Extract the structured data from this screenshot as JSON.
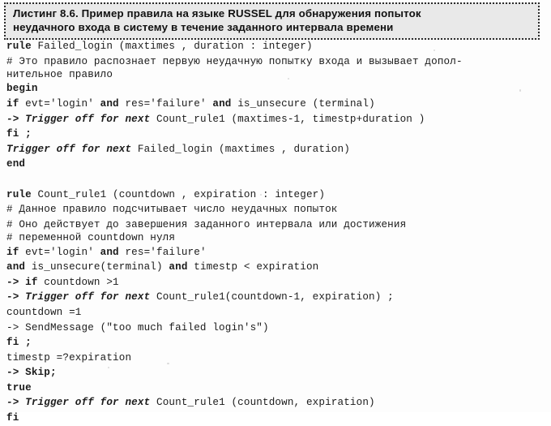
{
  "caption": {
    "line1": "Листинг 8.6. Пример правила на языке RUSSEL для обнаружения попыток",
    "line2": "неудачного входа в систему в течение заданного интервала времени"
  },
  "colors": {
    "page_background": "#fdfdfd",
    "caption_background": "#e9e9e9",
    "caption_border": "#2b2b2b",
    "text": "#1b1b1b"
  },
  "listing": {
    "language": "RUSSEL",
    "lines": [
      {
        "id": "l01",
        "kw": "rule",
        "rest": " Failed_login (maxtimes , duration : integer)"
      },
      {
        "id": "l02",
        "kw": "",
        "rest": "# Это правило распознает первую неудачную попытку входа и вызывает допол-"
      },
      {
        "id": "l03",
        "kw": "",
        "rest": "нительное правило"
      },
      {
        "id": "l04",
        "kw": "begin",
        "rest": ""
      },
      {
        "id": "l05",
        "kw": "if",
        "rest": " evt='login' ",
        "kw2": "and",
        "rest2": " res='failure' ",
        "kw3": "and",
        "rest3": " is_unsecure (terminal)"
      },
      {
        "id": "l06",
        "kw": "-> Trigger off for next",
        "rest": " Count_rule1 (maxtimes-1, timestp+duration )"
      },
      {
        "id": "l07",
        "kw": "fi ;",
        "rest": ""
      },
      {
        "id": "l08",
        "kw": "Trigger off for next",
        "rest": " Failed_login (maxtimes , duration)"
      },
      {
        "id": "l09",
        "kw": "end",
        "rest": ""
      },
      {
        "id": "l10",
        "kw": "",
        "rest": ""
      },
      {
        "id": "l11",
        "kw": "rule",
        "rest": " Count_rule1 (countdown , expiration : integer)"
      },
      {
        "id": "l12",
        "kw": "",
        "rest": "# Данное правило подсчитывает число неудачных попыток"
      },
      {
        "id": "l13",
        "kw": "",
        "rest": "# Оно действует до завершения заданного интервала или достижения"
      },
      {
        "id": "l14",
        "kw": "",
        "rest": "# переменной countdown нуля"
      },
      {
        "id": "l15",
        "kw": "if",
        "rest": " evt='login' ",
        "kw2": "and",
        "rest2": " res='failure'"
      },
      {
        "id": "l16",
        "kw": "and",
        "rest": " is_unsecure(terminal) ",
        "kw2": "and",
        "rest2": " timestp < expiration"
      },
      {
        "id": "l17",
        "kw": "-> if",
        "rest": " countdown >1"
      },
      {
        "id": "l18",
        "kw": "-> Trigger off for next",
        "rest": " Count_rule1(countdown-1, expiration) ;"
      },
      {
        "id": "l19",
        "kw": "",
        "rest": "countdown =1"
      },
      {
        "id": "l20",
        "kw": "",
        "rest": "-> SendMessage (\"too much failed login's\")"
      },
      {
        "id": "l21",
        "kw": "fi ;",
        "rest": ""
      },
      {
        "id": "l22",
        "kw": "",
        "rest": "timestp =?expiration"
      },
      {
        "id": "l23",
        "kw": "-> Skip;",
        "rest": ""
      },
      {
        "id": "l24",
        "kw": "true",
        "rest": ""
      },
      {
        "id": "l25",
        "kw": "-> Trigger off for next",
        "rest": " Count_rule1 (countdown, expiration)"
      },
      {
        "id": "l26",
        "kw": "fi",
        "rest": ""
      }
    ]
  }
}
